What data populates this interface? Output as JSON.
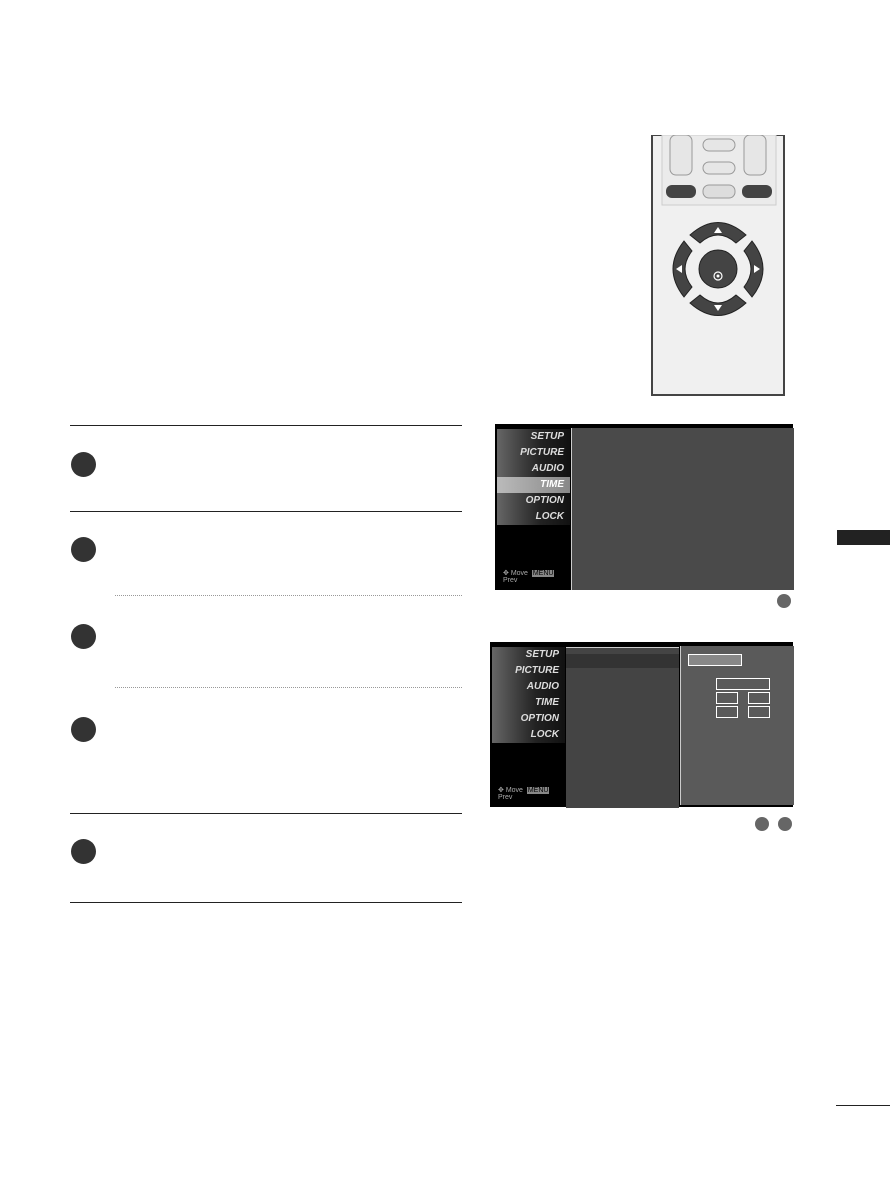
{
  "menu_items": [
    "SETUP",
    "PICTURE",
    "AUDIO",
    "TIME",
    "OPTION",
    "LOCK"
  ],
  "footer": {
    "move": "Move",
    "menu_key": "MENU",
    "prev": "Prev"
  },
  "selected_item": "TIME",
  "colors": {
    "menu_bg": "#000000",
    "panel": "#4a4a4a",
    "step_badge": "#333333"
  },
  "remote": {
    "icons": [
      "up-arrow-icon",
      "down-arrow-icon",
      "left-arrow-icon",
      "right-arrow-icon",
      "ok-icon"
    ]
  }
}
